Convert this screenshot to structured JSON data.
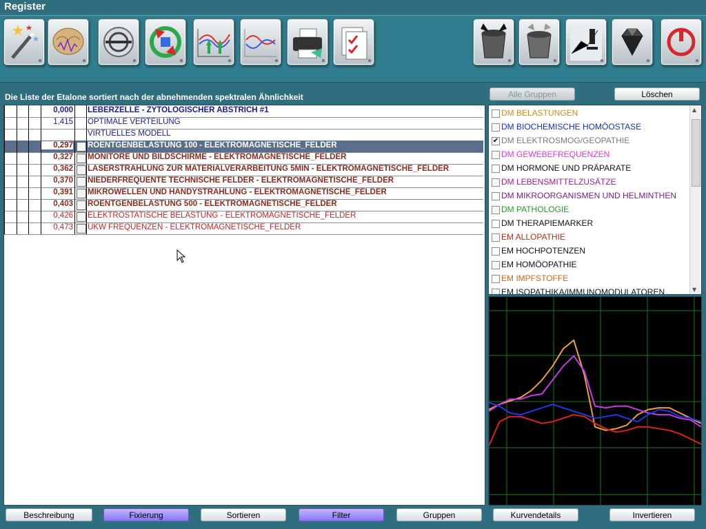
{
  "app": {
    "title": "Register"
  },
  "toolbar": {
    "buttons": [
      {
        "icon": "magic-wand-icon"
      },
      {
        "icon": "brain-icon"
      },
      {
        "icon": "spiral-icon"
      },
      {
        "icon": "recycle-icon"
      },
      {
        "icon": "up-arrows-chart-icon"
      },
      {
        "icon": "wave-chart-icon"
      },
      {
        "icon": "printer-icon"
      },
      {
        "icon": "checklist-icon"
      },
      {
        "icon": "bucket-in-icon"
      },
      {
        "icon": "bucket-out-icon"
      },
      {
        "icon": "microscope-icon"
      },
      {
        "icon": "gem-icon"
      },
      {
        "icon": "power-icon"
      }
    ]
  },
  "list": {
    "heading": "Die Liste der Etalone sortiert nach der abnehmenden spektralen Ähnlichkeit",
    "rows": [
      {
        "value": "0,000",
        "name": "LEBERZELLE - ZYTOLOGISCHER ABSTRICH #1",
        "color": "#1a1a8c",
        "bold": true,
        "checkbox": false,
        "selected": false
      },
      {
        "value": "1,415",
        "name": "OPTIMALE VERTEILUNG",
        "color": "#1a1a8c",
        "bold": false,
        "checkbox": false,
        "selected": false
      },
      {
        "value": "",
        "name": "VIRTUELLES MODELL",
        "color": "#1a1a8c",
        "bold": false,
        "checkbox": false,
        "selected": false
      },
      {
        "value": "0,297",
        "name": "ROENTGENBELASTUNG 100 - ELEKTROMAGNETISCHE_FELDER",
        "color": "#ffffff",
        "bold": true,
        "checkbox": true,
        "selected": true,
        "value_color": "#7b1f1f"
      },
      {
        "value": "0,327",
        "name": "MONITORE UND BILDSCHIRME - ELEKTROMAGNETISCHE_FELDER",
        "color": "#8b2b1f",
        "bold": true,
        "checkbox": true,
        "selected": false
      },
      {
        "value": "0,362",
        "name": "LASERSTRAHLUNG ZUR MATERIALVERARBEITUNG 5MIN - ELEKTROMAGNETISCHE_FELDER",
        "color": "#8b2b1f",
        "bold": true,
        "checkbox": true,
        "selected": false
      },
      {
        "value": "0,370",
        "name": "NIEDERFREQUENTE TECHNISCHE FELDER - ELEKTROMAGNETISCHE_FELDER",
        "color": "#8b2b1f",
        "bold": true,
        "checkbox": true,
        "selected": false
      },
      {
        "value": "0,391",
        "name": "MIKROWELLEN UND HANDYSTRAHLUNG - ELEKTROMAGNETISCHE_FELDER",
        "color": "#8b2b1f",
        "bold": true,
        "checkbox": true,
        "selected": false
      },
      {
        "value": "0,403",
        "name": "ROENTGENBELASTUNG 500 - ELEKTROMAGNETISCHE_FELDER",
        "color": "#8b2b1f",
        "bold": true,
        "checkbox": true,
        "selected": false
      },
      {
        "value": "0,426",
        "name": "ELEKTROSTATISCHE BELASTUNG - ELEKTROMAGNETISCHE_FELDER",
        "color": "#c0282a",
        "bold": false,
        "checkbox": true,
        "selected": false
      },
      {
        "value": "0,473",
        "name": "UKW FREQUENZEN - ELEKTROMAGNETISCHE_FELDER",
        "color": "#c0282a",
        "bold": false,
        "checkbox": true,
        "selected": false
      }
    ]
  },
  "right_buttons": {
    "alle_gruppen": "Alle Gruppen",
    "loeschen": "Löschen"
  },
  "groups": [
    {
      "label": "DM BELASTUNGEN",
      "color": "#d98a1e",
      "checked": false
    },
    {
      "label": "DM BIOCHEMISCHE HOMÖOSTASE",
      "color": "#1a2fbf",
      "checked": false
    },
    {
      "label": "DM ELEKTROSMOG/GEOPATHIE",
      "color": "#7a7a7a",
      "checked": true
    },
    {
      "label": "DM GEWEBEFREQUENZEN",
      "color": "#e13ad9",
      "checked": false
    },
    {
      "label": "DM HORMONE UND PRÄPARATE",
      "color": "#111111",
      "checked": false
    },
    {
      "label": "DM LEBENSMITTELZUSÄTZE",
      "color": "#a51f8a",
      "checked": false
    },
    {
      "label": "DM MIKROORGANISMEN UND HELMINTHEN",
      "color": "#7a1f8a",
      "checked": false
    },
    {
      "label": "DM PATHOLOGIE",
      "color": "#2a9a2a",
      "checked": false
    },
    {
      "label": "DM THERAPIEMARKER",
      "color": "#111111",
      "checked": false
    },
    {
      "label": "EM ALLOPATHIE",
      "color": "#a8331f",
      "checked": false
    },
    {
      "label": "EM HOCHPOTENZEN",
      "color": "#111111",
      "checked": false
    },
    {
      "label": "EM HOMÖOPATHIE",
      "color": "#111111",
      "checked": false
    },
    {
      "label": "EM IMPFSTOFFE",
      "color": "#e0631f",
      "checked": false
    },
    {
      "label": "EM ISOPATHIKA/IMMUNOMODULATOREN",
      "color": "#111111",
      "checked": false
    }
  ],
  "bottom_buttons": {
    "beschreibung": "Beschreibung",
    "fixierung": "Fixierung",
    "sortieren": "Sortieren",
    "filter": "Filter",
    "gruppen": "Gruppen",
    "kurvendetails": "Kurvendetails",
    "invertieren": "Invertieren"
  },
  "chart_data": {
    "type": "line",
    "grid": true,
    "background": "#000000",
    "grid_color": "#1f7a1f",
    "x": [
      0,
      1,
      2,
      3,
      4,
      5,
      6,
      7,
      8,
      9,
      10,
      11,
      12,
      13,
      14,
      15,
      16,
      17,
      18,
      19,
      20
    ],
    "series": [
      {
        "color": "#f0a040",
        "values": [
          55,
          58,
          60,
          62,
          66,
          72,
          80,
          90,
          95,
          75,
          45,
          43,
          44,
          46,
          52,
          55,
          56,
          56,
          53,
          50,
          47
        ]
      },
      {
        "color": "#c33ce8",
        "values": [
          54,
          58,
          61,
          61,
          63,
          64,
          72,
          80,
          86,
          77,
          57,
          56,
          57,
          57,
          55,
          53,
          52,
          52,
          50,
          49,
          45
        ]
      },
      {
        "color": "#2038e8",
        "values": [
          59,
          57,
          53,
          52,
          54,
          56,
          58,
          56,
          54,
          52,
          50,
          51,
          52,
          50,
          48,
          52,
          55,
          54,
          51,
          50,
          48
        ]
      },
      {
        "color": "#e02020",
        "values": [
          34,
          48,
          51,
          51,
          49,
          47,
          48,
          50,
          52,
          51,
          47,
          44,
          42,
          43,
          45,
          45,
          44,
          43,
          41,
          38,
          35
        ]
      }
    ],
    "ylim": [
      0,
      120
    ]
  }
}
